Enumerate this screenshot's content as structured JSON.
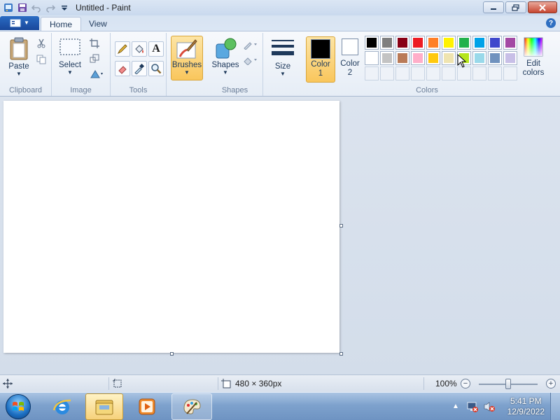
{
  "window": {
    "title": "Untitled - Paint"
  },
  "tabs": [
    {
      "label": "Home",
      "active": true
    },
    {
      "label": "View",
      "active": false
    }
  ],
  "ribbon": {
    "clipboard": {
      "paste_label": "Paste",
      "group_label": "Clipboard"
    },
    "image": {
      "select_label": "Select",
      "group_label": "Image"
    },
    "tools": {
      "group_label": "Tools"
    },
    "brushes": {
      "label": "Brushes"
    },
    "shapes": {
      "shapes_label": "Shapes",
      "group_label": "Shapes"
    },
    "size": {
      "label": "Size"
    },
    "colors": {
      "color1_label_line1": "Color",
      "color1_label_line2": "1",
      "color2_label_line1": "Color",
      "color2_label_line2": "2",
      "color1_value": "#000000",
      "color2_value": "#ffffff",
      "edit_label_line1": "Edit",
      "edit_label_line2": "colors",
      "group_label": "Colors",
      "palette_row1": [
        "#000000",
        "#7f7f7f",
        "#880015",
        "#ed1c24",
        "#ff7f27",
        "#fff200",
        "#22b14c",
        "#00a2e8",
        "#3f48cc",
        "#a349a4"
      ],
      "palette_row2": [
        "#ffffff",
        "#c3c3c3",
        "#b97a57",
        "#ffaec9",
        "#ffc90e",
        "#efe4b0",
        "#b5e61d",
        "#99d9ea",
        "#7092be",
        "#c8bfe7"
      ]
    }
  },
  "statusbar": {
    "canvas_size": "480 × 360px",
    "zoom": "100%",
    "zoom_fraction": 0.5
  },
  "taskbar": {
    "time": "5:41 PM",
    "date": "12/9/2022"
  }
}
